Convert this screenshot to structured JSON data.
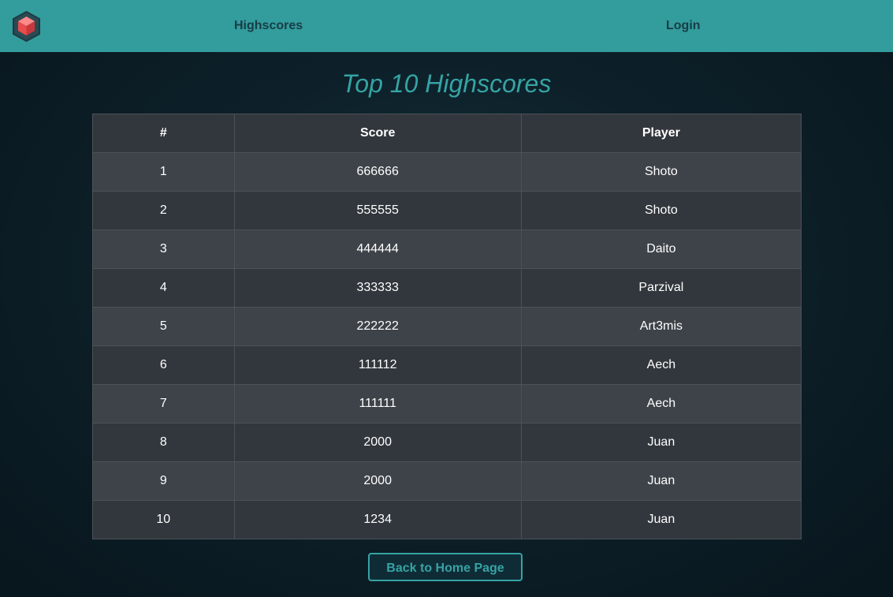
{
  "nav": {
    "highscores_label": "Highscores",
    "login_label": "Login",
    "logo_icon": "cube-logo-icon"
  },
  "page": {
    "title": "Top 10 Highscores"
  },
  "table": {
    "headers": [
      "#",
      "Score",
      "Player"
    ],
    "rows": [
      {
        "rank": "1",
        "score": "666666",
        "player": "Shoto"
      },
      {
        "rank": "2",
        "score": "555555",
        "player": "Shoto"
      },
      {
        "rank": "3",
        "score": "444444",
        "player": "Daito"
      },
      {
        "rank": "4",
        "score": "333333",
        "player": "Parzival"
      },
      {
        "rank": "5",
        "score": "222222",
        "player": "Art3mis"
      },
      {
        "rank": "6",
        "score": "111112",
        "player": "Aech"
      },
      {
        "rank": "7",
        "score": "111111",
        "player": "Aech"
      },
      {
        "rank": "8",
        "score": "2000",
        "player": "Juan"
      },
      {
        "rank": "9",
        "score": "2000",
        "player": "Juan"
      },
      {
        "rank": "10",
        "score": "1234",
        "player": "Juan"
      }
    ]
  },
  "actions": {
    "back_label": "Back to Home Page"
  },
  "colors": {
    "navbar": "#339c9c",
    "accent": "#36a3a4",
    "nav_text": "#173d46",
    "row_light": "#3e4349",
    "row_dark": "#32373d"
  }
}
